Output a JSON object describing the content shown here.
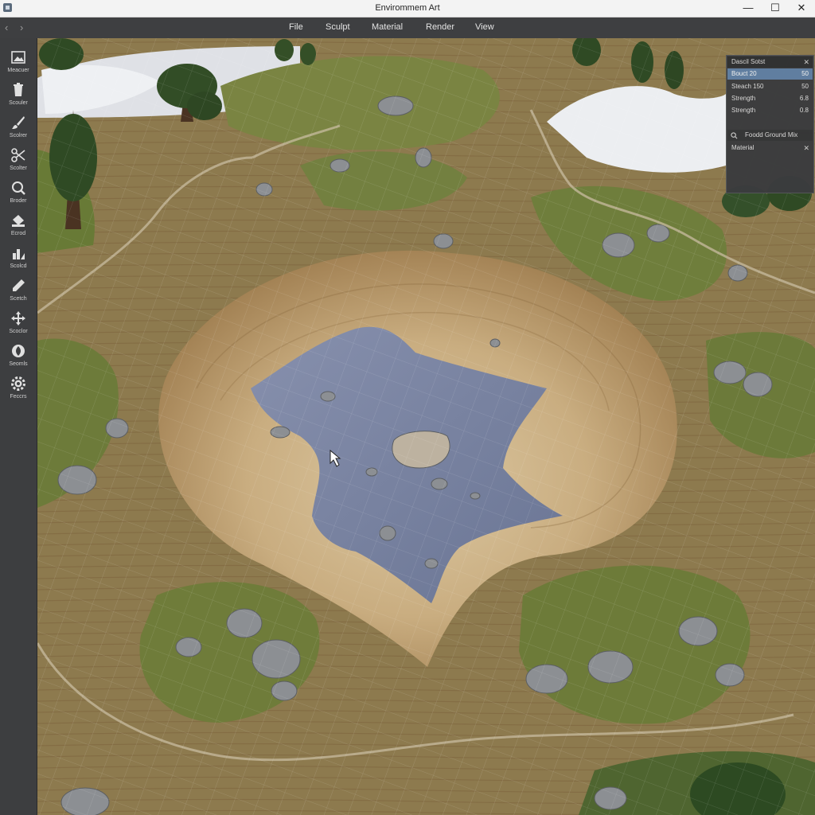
{
  "window": {
    "title": "Envirommem Art",
    "controls": {
      "minimize": "—",
      "maximize": "☐",
      "close": "✕"
    }
  },
  "menubar": {
    "back_glyph": "‹",
    "forward_glyph": "›",
    "items": [
      "File",
      "Sculpt",
      "Material",
      "Render",
      "View"
    ]
  },
  "toolbar": {
    "tools": [
      {
        "label": "Meacuer",
        "icon": "image-icon"
      },
      {
        "label": "Scouler",
        "icon": "trash-icon"
      },
      {
        "label": "Scolrer",
        "icon": "brush-icon"
      },
      {
        "label": "Scolter",
        "icon": "scissors-icon"
      },
      {
        "label": "Broder",
        "icon": "magnifier-icon"
      },
      {
        "label": "Ecrod",
        "icon": "bucket-icon"
      },
      {
        "label": "Scolcd",
        "icon": "chart-icon"
      },
      {
        "label": "Scetch",
        "icon": "pencil-icon"
      },
      {
        "label": "Scoclor",
        "icon": "move-icon"
      },
      {
        "label": "Seomls",
        "icon": "leaf-icon"
      },
      {
        "label": "Feccrs",
        "icon": "gear-icon"
      }
    ]
  },
  "panel": {
    "header": "Dascil Sotst",
    "rows": [
      {
        "label": "Bouct 20",
        "value": "50",
        "selected": true
      },
      {
        "label": "Steach 150",
        "value": "50",
        "selected": false
      },
      {
        "label": "Strength",
        "value": "6.8",
        "selected": false
      },
      {
        "label": "Strength",
        "value": "0.8",
        "selected": false
      }
    ],
    "layer": "Foodd Ground Mix",
    "material": "Material"
  },
  "colors": {
    "accent": "#5f7fa3",
    "titlebar": "#f3f3f3",
    "chrome": "#3e3f41",
    "water": "#7783a0",
    "grass": "#6e7c3c",
    "soil": "#a58659"
  }
}
